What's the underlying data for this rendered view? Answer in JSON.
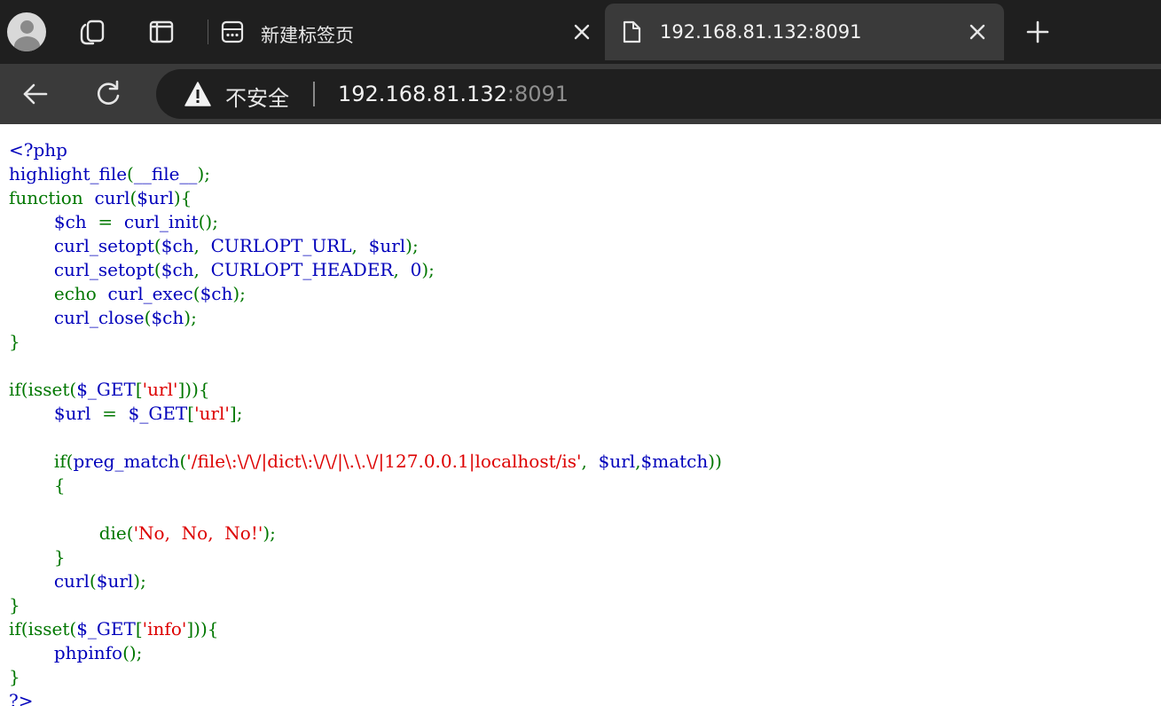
{
  "tabs": {
    "inactive": {
      "label": "新建标签页",
      "icon": "dashboard-icon"
    },
    "active": {
      "label": "192.168.81.132:8091",
      "icon": "document-icon"
    }
  },
  "toolbar": {
    "security_label": "不安全",
    "url_host": "192.168.81.132",
    "url_port": ":8091"
  },
  "icons": {
    "profile": "avatar",
    "collections": "collections-icon",
    "tab_actions": "tab-actions-icon",
    "back": "back-arrow-icon",
    "reload": "reload-icon",
    "warning": "warning-icon",
    "new_tab": "plus-icon",
    "close": "close-icon"
  },
  "colors": {
    "default": "#0000bb",
    "keyword": "#007700",
    "string": "#dd0000",
    "chrome_dark": "#1f1f1f",
    "chrome_mid": "#3a3a3a"
  },
  "code": {
    "lines": [
      [
        [
          "d",
          "<?php"
        ]
      ],
      [
        [
          "d",
          "highlight_file"
        ],
        [
          "k",
          "("
        ],
        [
          "d",
          "__file__"
        ],
        [
          "k",
          ");"
        ]
      ],
      [
        [
          "k",
          "function  "
        ],
        [
          "d",
          "curl"
        ],
        [
          "k",
          "("
        ],
        [
          "d",
          "$url"
        ],
        [
          "k",
          "){"
        ]
      ],
      [
        [
          "k",
          "        "
        ],
        [
          "d",
          "$ch  "
        ],
        [
          "k",
          "=  "
        ],
        [
          "d",
          "curl_init"
        ],
        [
          "k",
          "();"
        ]
      ],
      [
        [
          "k",
          "        "
        ],
        [
          "d",
          "curl_setopt"
        ],
        [
          "k",
          "("
        ],
        [
          "d",
          "$ch"
        ],
        [
          "k",
          ",  "
        ],
        [
          "d",
          "CURLOPT_URL"
        ],
        [
          "k",
          ",  "
        ],
        [
          "d",
          "$url"
        ],
        [
          "k",
          ");"
        ]
      ],
      [
        [
          "k",
          "        "
        ],
        [
          "d",
          "curl_setopt"
        ],
        [
          "k",
          "("
        ],
        [
          "d",
          "$ch"
        ],
        [
          "k",
          ",  "
        ],
        [
          "d",
          "CURLOPT_HEADER"
        ],
        [
          "k",
          ",  "
        ],
        [
          "d",
          "0"
        ],
        [
          "k",
          ");"
        ]
      ],
      [
        [
          "k",
          "        echo  "
        ],
        [
          "d",
          "curl_exec"
        ],
        [
          "k",
          "("
        ],
        [
          "d",
          "$ch"
        ],
        [
          "k",
          ");"
        ]
      ],
      [
        [
          "k",
          "        "
        ],
        [
          "d",
          "curl_close"
        ],
        [
          "k",
          "("
        ],
        [
          "d",
          "$ch"
        ],
        [
          "k",
          ");"
        ]
      ],
      [
        [
          "k",
          "}"
        ]
      ],
      [
        [
          "k",
          ""
        ]
      ],
      [
        [
          "k",
          "if(isset("
        ],
        [
          "d",
          "$_GET"
        ],
        [
          "k",
          "["
        ],
        [
          "s",
          "'url'"
        ],
        [
          "k",
          "])){"
        ]
      ],
      [
        [
          "k",
          "        "
        ],
        [
          "d",
          "$url  "
        ],
        [
          "k",
          "=  "
        ],
        [
          "d",
          "$_GET"
        ],
        [
          "k",
          "["
        ],
        [
          "s",
          "'url'"
        ],
        [
          "k",
          "];"
        ]
      ],
      [
        [
          "k",
          ""
        ]
      ],
      [
        [
          "k",
          "        if("
        ],
        [
          "d",
          "preg_match"
        ],
        [
          "k",
          "("
        ],
        [
          "s",
          "'/file\\:\\/\\/|dict\\:\\/\\/|\\.\\.\\/|127.0.0.1|localhost/is'"
        ],
        [
          "k",
          ",  "
        ],
        [
          "d",
          "$url"
        ],
        [
          "k",
          ","
        ],
        [
          "d",
          "$match"
        ],
        [
          "k",
          "))"
        ]
      ],
      [
        [
          "k",
          "        {"
        ]
      ],
      [
        [
          "k",
          ""
        ]
      ],
      [
        [
          "k",
          "                die("
        ],
        [
          "s",
          "'No,  No,  No!'"
        ],
        [
          "k",
          ");"
        ]
      ],
      [
        [
          "k",
          "        }"
        ]
      ],
      [
        [
          "k",
          "        "
        ],
        [
          "d",
          "curl"
        ],
        [
          "k",
          "("
        ],
        [
          "d",
          "$url"
        ],
        [
          "k",
          ");"
        ]
      ],
      [
        [
          "k",
          "}"
        ]
      ],
      [
        [
          "k",
          "if(isset("
        ],
        [
          "d",
          "$_GET"
        ],
        [
          "k",
          "["
        ],
        [
          "s",
          "'info'"
        ],
        [
          "k",
          "])){"
        ]
      ],
      [
        [
          "k",
          "        "
        ],
        [
          "d",
          "phpinfo"
        ],
        [
          "k",
          "();"
        ]
      ],
      [
        [
          "k",
          "}"
        ]
      ],
      [
        [
          "d",
          "?>"
        ]
      ]
    ]
  }
}
